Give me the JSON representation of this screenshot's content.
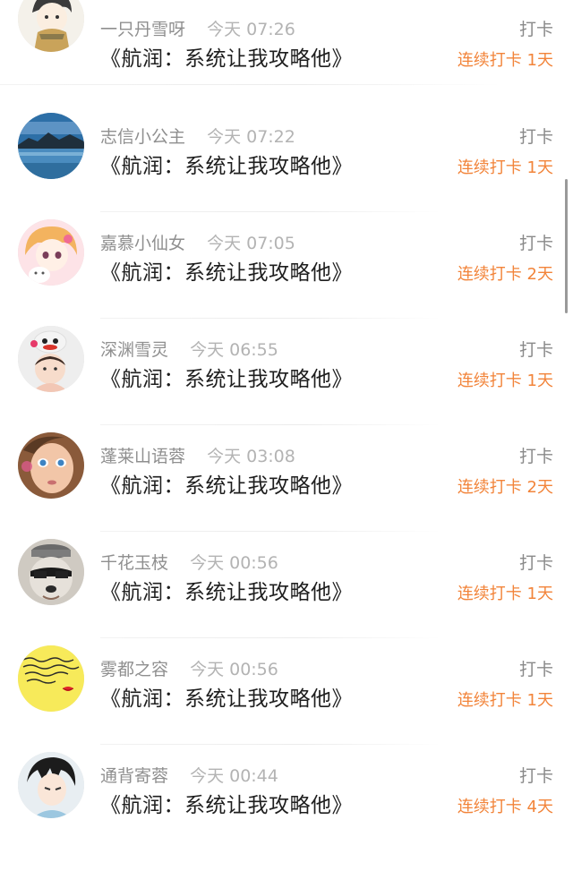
{
  "items": [
    {
      "name": "一只丹雪呀",
      "time": "今天 07:26",
      "book": "《航润：系统让我攻略他》",
      "checkin": "打卡",
      "streak": "连续打卡 1天",
      "avatar": "cartoon-boy-avatar"
    },
    {
      "name": "志信小公主",
      "time": "今天 07:22",
      "book": "《航润：系统让我攻略他》",
      "checkin": "打卡",
      "streak": "连续打卡 1天",
      "avatar": "lake-landscape-avatar"
    },
    {
      "name": "嘉慕小仙女",
      "time": "今天 07:05",
      "book": "《航润：系统让我攻略他》",
      "checkin": "打卡",
      "streak": "连续打卡 2天",
      "avatar": "anime-girl-avatar"
    },
    {
      "name": "深渊雪灵",
      "time": "今天 06:55",
      "book": "《航润：系统让我攻略他》",
      "checkin": "打卡",
      "streak": "连续打卡 1天",
      "avatar": "child-with-hat-avatar"
    },
    {
      "name": "蓬莱山语蓉",
      "time": "今天 03:08",
      "book": "《航润：系统让我攻略他》",
      "checkin": "打卡",
      "streak": "连续打卡 2天",
      "avatar": "doll-face-avatar"
    },
    {
      "name": "千花玉枝",
      "time": "今天 00:56",
      "book": "《航润：系统让我攻略他》",
      "checkin": "打卡",
      "streak": "连续打卡 1天",
      "avatar": "dog-with-glasses-avatar"
    },
    {
      "name": "雾都之容",
      "time": "今天 00:56",
      "book": "《航润：系统让我攻略他》",
      "checkin": "打卡",
      "streak": "连续打卡 1天",
      "avatar": "handwriting-note-avatar"
    },
    {
      "name": "通背寄蓉",
      "time": "今天 00:44",
      "book": "《航润：系统让我攻略他》",
      "checkin": "打卡",
      "streak": "连续打卡 4天",
      "avatar": "anime-boy-avatar"
    }
  ],
  "colors": {
    "streak": "#f2843a",
    "name": "#8f8f8f",
    "time": "#b3b3b3",
    "book": "#1e1e1e"
  }
}
